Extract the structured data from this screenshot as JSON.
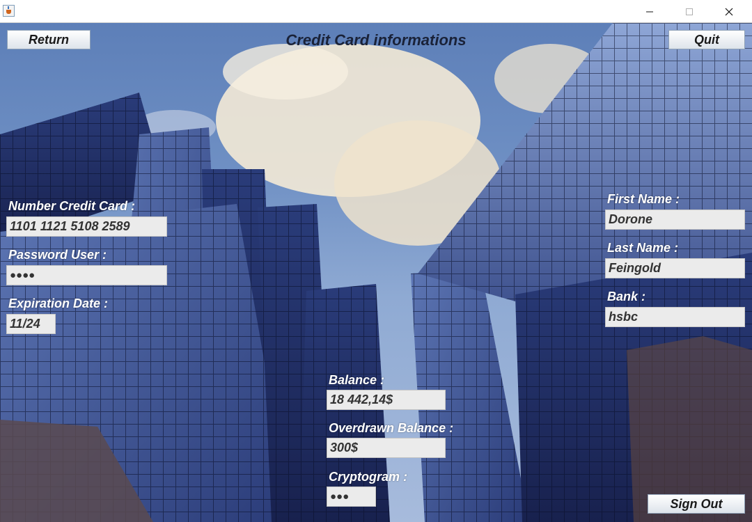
{
  "window": {
    "controls": {
      "minimize": "─",
      "maximize": "☐",
      "close": "✕"
    }
  },
  "toolbar": {
    "return_label": "Return",
    "quit_label": "Quit",
    "signout_label": "Sign Out"
  },
  "page": {
    "title": "Credit Card informations"
  },
  "left": {
    "card_number": {
      "label": "Number Credit Card :",
      "value": "1101 1121 5108 2589"
    },
    "password": {
      "label": "Password User :",
      "value": "●●●●"
    },
    "expiration": {
      "label": "Expiration Date :",
      "value": "11/24"
    }
  },
  "right": {
    "first_name": {
      "label": "First Name :",
      "value": "Dorone"
    },
    "last_name": {
      "label": "Last Name :",
      "value": "Feingold"
    },
    "bank": {
      "label": "Bank :",
      "value": "hsbc"
    }
  },
  "center": {
    "balance": {
      "label": "Balance :",
      "value": "18 442,14$"
    },
    "overdrawn": {
      "label": "Overdrawn Balance :",
      "value": "300$"
    },
    "cryptogram": {
      "label": "Cryptogram :",
      "value": "●●●"
    }
  },
  "colors": {
    "sky": "#6f90c4",
    "field_bg": "#ebebeb",
    "label_text": "#ffffff",
    "title_text": "#1a2238"
  }
}
